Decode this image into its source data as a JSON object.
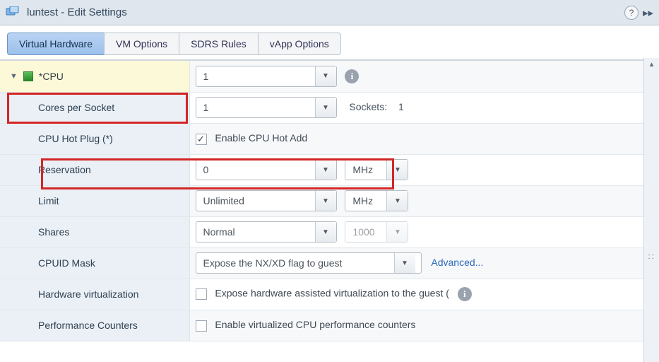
{
  "title": "luntest - Edit Settings",
  "tabs": [
    "Virtual Hardware",
    "VM Options",
    "SDRS Rules",
    "vApp Options"
  ],
  "section_header": "*CPU",
  "rows": {
    "cpu_value": "1",
    "cores_label": "Cores per Socket",
    "cores_value": "1",
    "sockets_label": "Sockets:",
    "sockets_value": "1",
    "hotplug_label": "CPU Hot Plug (*)",
    "hotplug_cb_label": "Enable CPU Hot Add",
    "reservation_label": "Reservation",
    "reservation_value": "0",
    "reservation_unit": "MHz",
    "limit_label": "Limit",
    "limit_value": "Unlimited",
    "limit_unit": "MHz",
    "shares_label": "Shares",
    "shares_value": "Normal",
    "shares_num": "1000",
    "cpuid_label": "CPUID Mask",
    "cpuid_value": "Expose the NX/XD flag to guest",
    "cpuid_link": "Advanced...",
    "hwvirt_label": "Hardware virtualization",
    "hwvirt_cb_label": "Expose hardware assisted virtualization to the guest (",
    "perf_label": "Performance Counters",
    "perf_cb_label": "Enable virtualized CPU performance counters"
  }
}
